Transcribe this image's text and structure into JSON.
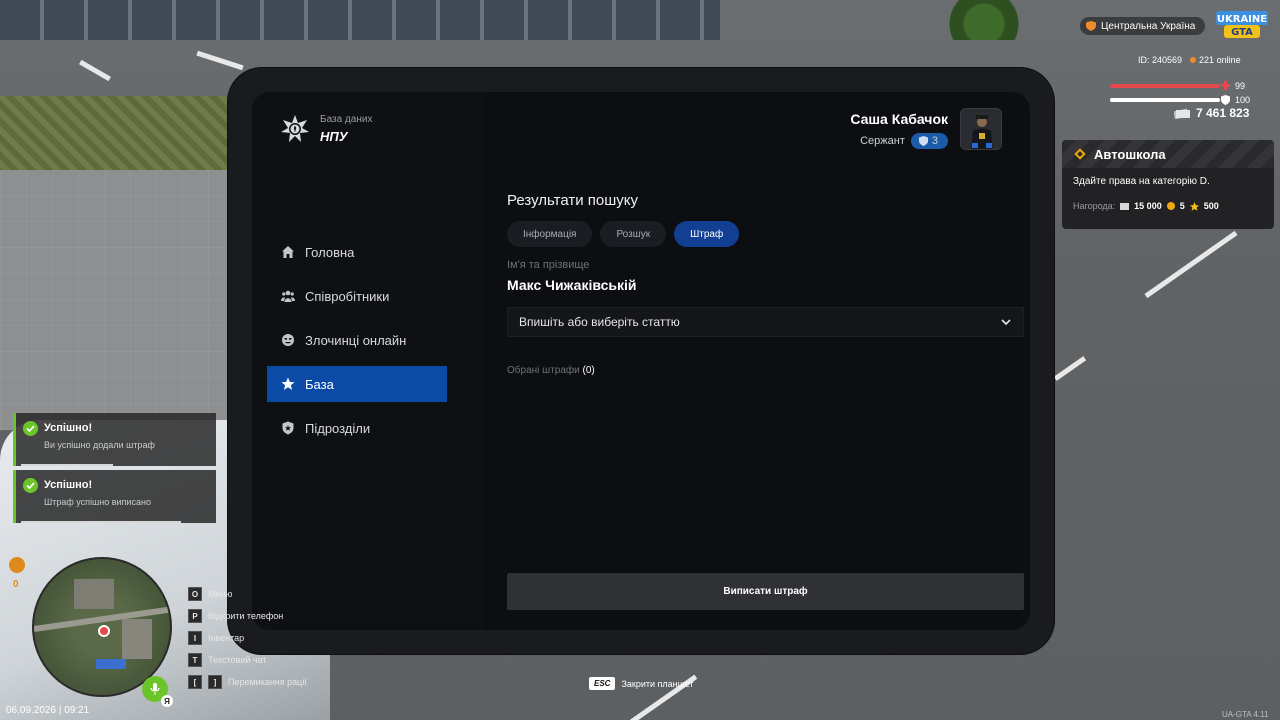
{
  "app": {
    "brand_subtitle": "База даних",
    "brand_title": "НПУ"
  },
  "profile": {
    "name": "Саша Кабачок",
    "rank": "Сержант",
    "rank_level": "3"
  },
  "sidebar": {
    "items": [
      {
        "label": "Головна",
        "icon": "home-icon",
        "active": false
      },
      {
        "label": "Співробітники",
        "icon": "users-icon",
        "active": false
      },
      {
        "label": "Злочинці онлайн",
        "icon": "criminal-icon",
        "active": false
      },
      {
        "label": "База",
        "icon": "star-icon",
        "active": true
      },
      {
        "label": "Підрозділи",
        "icon": "shield-icon",
        "active": false
      }
    ]
  },
  "main": {
    "title": "Результати пошуку",
    "tabs": [
      {
        "label": "Інформація",
        "active": false
      },
      {
        "label": "Розшук",
        "active": false
      },
      {
        "label": "Штраф",
        "active": true
      }
    ],
    "name_label": "Ім'я та прізвище",
    "name_value": "Макс Чижаківській",
    "article_select_placeholder": "Впишіть або виберіть статтю",
    "selected_fines_label": "Обрані штрафи",
    "selected_fines_count": "(0)",
    "issue_button": "Виписати штраф"
  },
  "hud": {
    "region": "Центральна Україна",
    "logo_text": "UKRAINE GTA",
    "id": "ID: 240569",
    "online": "221 online",
    "health": "99",
    "armor": "100",
    "money": "7 461 823",
    "hunger": "0",
    "datetime": "06.09.2026 | 09:21",
    "version": "UA-GTA 4.11",
    "esc_key": "ESC",
    "esc_text": "Закрити планшет",
    "mic_label": "Я"
  },
  "quest": {
    "title": "Автошкола",
    "description": "Здайте права на категорію D.",
    "reward_label": "Нагорода:",
    "reward_money": "15 000",
    "reward_coins": "5",
    "reward_stars": "500"
  },
  "notifications": [
    {
      "title": "Успішно!",
      "text": "Ви успішно додали штраф"
    },
    {
      "title": "Успішно!",
      "text": "Штраф успішно виписано"
    }
  ],
  "keybinds": [
    {
      "keys": [
        "O"
      ],
      "label": "Меню"
    },
    {
      "keys": [
        "P"
      ],
      "label": "Відкрити телефон"
    },
    {
      "keys": [
        "I"
      ],
      "label": "Інвентар"
    },
    {
      "keys": [
        "T"
      ],
      "label": "Текстовий чат"
    },
    {
      "keys": [
        "[",
        "]"
      ],
      "label": "Перемикання рації"
    }
  ],
  "colors": {
    "accent": "#0b4aa6",
    "tab_active": "#123f91",
    "success": "#6ac42a",
    "health": "#e5484d",
    "armor": "#ffffff"
  }
}
